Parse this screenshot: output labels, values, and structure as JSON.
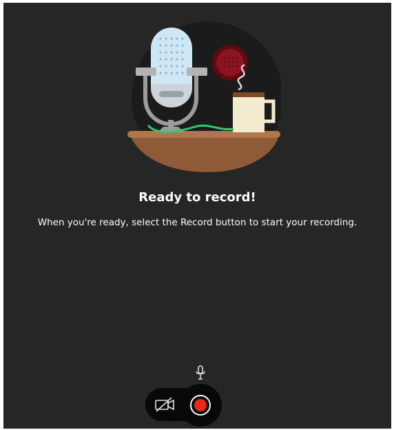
{
  "empty_state": {
    "title": "Ready to record!",
    "message": "When you're ready, select the Record button to start your recording."
  },
  "controls": {
    "microphone_icon": "microphone-icon",
    "camera_icon": "camera-off-icon",
    "record_icon": "record-icon"
  },
  "colors": {
    "background": "#262626",
    "record_accent": "#e8261c",
    "control_background": "#080808"
  }
}
